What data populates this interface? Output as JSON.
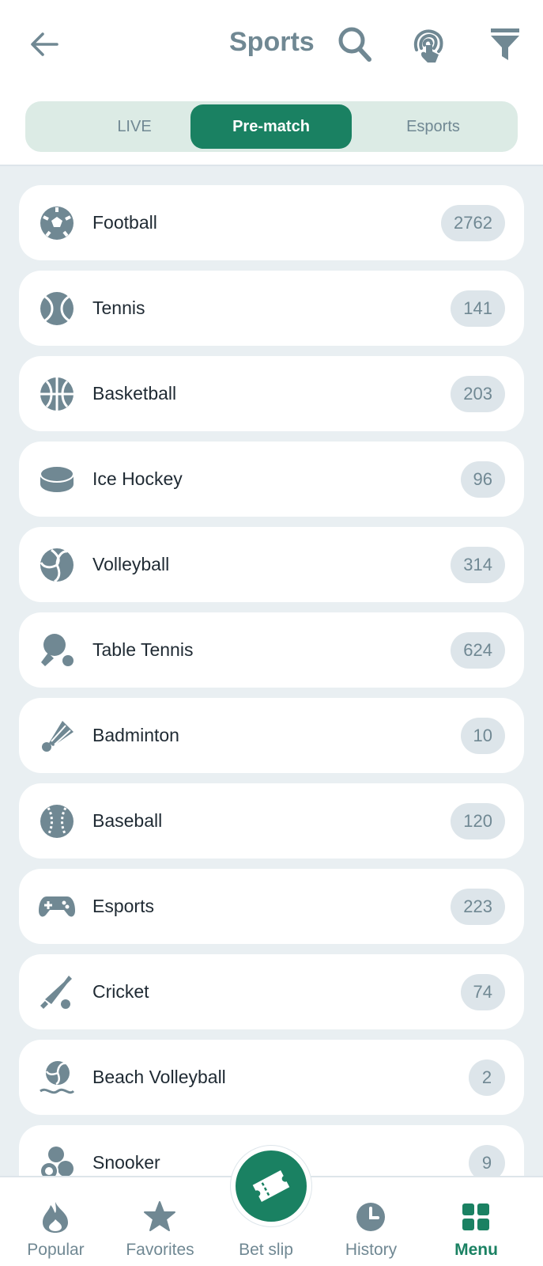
{
  "header": {
    "title": "Sports",
    "icons": {
      "back": "arrow-left-icon",
      "search": "search-icon",
      "fingerprint": "fingerprint-icon",
      "filter": "filter-icon"
    }
  },
  "tabs": [
    {
      "label": "LIVE",
      "active": false
    },
    {
      "label": "Pre-match",
      "active": true
    },
    {
      "label": "Esports",
      "active": false
    }
  ],
  "sports": [
    {
      "name": "Football",
      "count": "2762",
      "icon": "football-icon"
    },
    {
      "name": "Tennis",
      "count": "141",
      "icon": "tennis-ball-icon"
    },
    {
      "name": "Basketball",
      "count": "203",
      "icon": "basketball-icon"
    },
    {
      "name": "Ice Hockey",
      "count": "96",
      "icon": "hockey-puck-icon"
    },
    {
      "name": "Volleyball",
      "count": "314",
      "icon": "volleyball-icon"
    },
    {
      "name": "Table Tennis",
      "count": "624",
      "icon": "table-tennis-icon"
    },
    {
      "name": "Badminton",
      "count": "10",
      "icon": "shuttlecock-icon"
    },
    {
      "name": "Baseball",
      "count": "120",
      "icon": "baseball-icon"
    },
    {
      "name": "Esports",
      "count": "223",
      "icon": "gamepad-icon"
    },
    {
      "name": "Cricket",
      "count": "74",
      "icon": "cricket-icon"
    },
    {
      "name": "Beach Volleyball",
      "count": "2",
      "icon": "beach-volleyball-icon"
    },
    {
      "name": "Snooker",
      "count": "9",
      "icon": "snooker-icon"
    }
  ],
  "bottom_nav": [
    {
      "label": "Popular",
      "icon": "flame-icon",
      "active": false
    },
    {
      "label": "Favorites",
      "icon": "star-icon",
      "active": false
    },
    {
      "label": "Bet slip",
      "icon": "ticket-icon",
      "active": false
    },
    {
      "label": "History",
      "icon": "clock-icon",
      "active": false
    },
    {
      "label": "Menu",
      "icon": "grid-icon",
      "active": true
    }
  ],
  "colors": {
    "accent": "#1a8162",
    "icon_gray": "#708893",
    "badge_bg": "#dde5ea",
    "page_bg": "#e9eff2"
  }
}
